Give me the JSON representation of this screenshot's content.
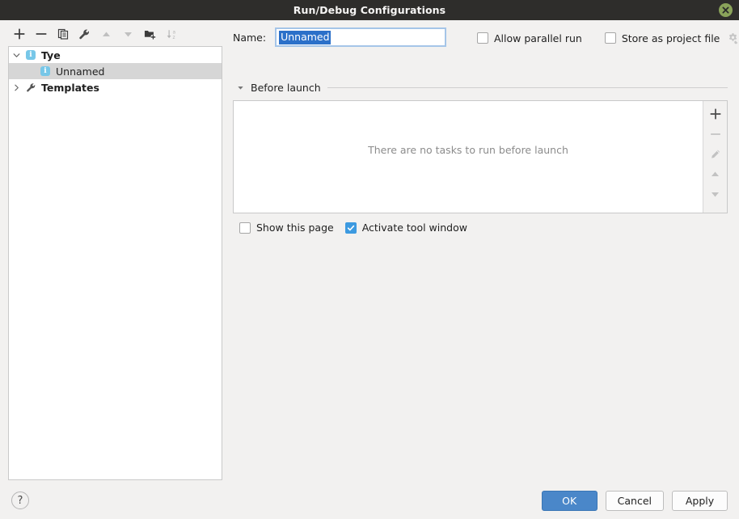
{
  "window": {
    "title": "Run/Debug Configurations",
    "close_icon": "close-icon"
  },
  "tree_toolbar": {
    "buttons": [
      {
        "name": "add-configuration-button",
        "icon": "plus-icon",
        "enabled": true
      },
      {
        "name": "remove-configuration-button",
        "icon": "minus-icon",
        "enabled": true
      },
      {
        "name": "copy-configuration-button",
        "icon": "copy-icon",
        "enabled": true
      },
      {
        "name": "edit-templates-button",
        "icon": "wrench-icon",
        "enabled": true
      },
      {
        "name": "move-up-button",
        "icon": "arrow-up-icon",
        "enabled": false
      },
      {
        "name": "move-down-button",
        "icon": "arrow-down-icon",
        "enabled": false
      },
      {
        "name": "create-folder-button",
        "icon": "folder-plus-icon",
        "enabled": true
      },
      {
        "name": "sort-configurations-button",
        "icon": "sort-az-icon",
        "enabled": false
      }
    ]
  },
  "tree": {
    "nodes": [
      {
        "label": "Tye",
        "icon": "tye-info-icon",
        "expanded": true,
        "bold": true,
        "selected": false,
        "level": 0,
        "has_arrow": true
      },
      {
        "label": "Unnamed",
        "icon": "tye-info-icon",
        "expanded": false,
        "bold": false,
        "selected": true,
        "level": 1,
        "has_arrow": false
      },
      {
        "label": "Templates",
        "icon": "wrench-icon",
        "expanded": false,
        "bold": true,
        "selected": false,
        "level": 0,
        "has_arrow": true
      }
    ]
  },
  "name_field": {
    "label": "Name:",
    "value": "Unnamed",
    "placeholder": "Unnamed",
    "selected_text": true
  },
  "top_options": {
    "allow_parallel_run": {
      "label": "Allow parallel run",
      "checked": false
    },
    "store_as_project_file": {
      "label": "Store as project file",
      "checked": false
    },
    "store_settings_icon": "gear-icon"
  },
  "before_launch": {
    "title": "Before launch",
    "expanded": true,
    "empty_text": "There are no tasks to run before launch",
    "tasks": [],
    "side_buttons": [
      {
        "name": "add-task-button",
        "icon": "plus-icon",
        "enabled": true
      },
      {
        "name": "remove-task-button",
        "icon": "minus-icon",
        "enabled": false
      },
      {
        "name": "edit-task-button",
        "icon": "pencil-icon",
        "enabled": false
      },
      {
        "name": "move-task-up-button",
        "icon": "arrow-up-icon",
        "enabled": false
      },
      {
        "name": "move-task-down-button",
        "icon": "arrow-down-icon",
        "enabled": false
      }
    ]
  },
  "bottom_options": {
    "show_this_page": {
      "label": "Show this page",
      "checked": false
    },
    "activate_tool_window": {
      "label": "Activate tool window",
      "checked": true
    }
  },
  "footer": {
    "help_label": "?",
    "ok_label": "OK",
    "cancel_label": "Cancel",
    "apply_label": "Apply"
  },
  "colors": {
    "titlebar_bg": "#2e2d2b",
    "close_button": "#8aa35a",
    "accent_primary": "#4a87c9",
    "checkbox_checked": "#3d9ae0",
    "selection_bg": "#2b70c9",
    "tree_selection": "#d6d6d6",
    "config_icon": "#77c7e8",
    "dialog_bg": "#f2f1f0"
  }
}
